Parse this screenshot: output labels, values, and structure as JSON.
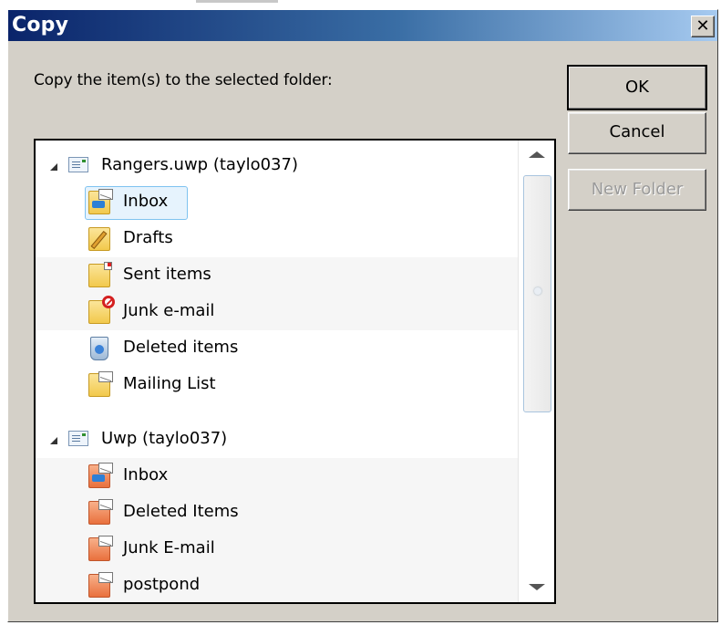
{
  "dialog": {
    "title": "Copy",
    "close_glyph": "✕",
    "prompt": "Copy the item(s) to the selected folder:"
  },
  "buttons": {
    "ok": "OK",
    "cancel": "Cancel",
    "new_folder": "New Folder"
  },
  "tree": {
    "accounts": [
      {
        "name": "Rangers.uwp (taylo037)",
        "expanded": true,
        "folders": [
          {
            "label": "Inbox",
            "icon": "inbox-folder-icon",
            "selected": true
          },
          {
            "label": "Drafts",
            "icon": "drafts-folder-icon"
          },
          {
            "label": "Sent items",
            "icon": "sent-folder-icon"
          },
          {
            "label": "Junk e-mail",
            "icon": "junk-folder-icon"
          },
          {
            "label": "Deleted items",
            "icon": "deleted-folder-icon"
          },
          {
            "label": "Mailing List",
            "icon": "mail-folder-icon"
          }
        ]
      },
      {
        "name": "Uwp (taylo037)",
        "expanded": true,
        "folders": [
          {
            "label": "Inbox",
            "icon": "inbox-folder-icon"
          },
          {
            "label": "Deleted Items",
            "icon": "mail-folder-icon"
          },
          {
            "label": "Junk E-mail",
            "icon": "mail-folder-icon"
          },
          {
            "label": "postpond",
            "icon": "mail-folder-icon"
          }
        ]
      }
    ]
  },
  "colors": {
    "titlebar_start": "#0a246a",
    "titlebar_end": "#a6caf0",
    "dialog_bg": "#d4d0c8",
    "selection_bg": "#e6f3fd"
  }
}
